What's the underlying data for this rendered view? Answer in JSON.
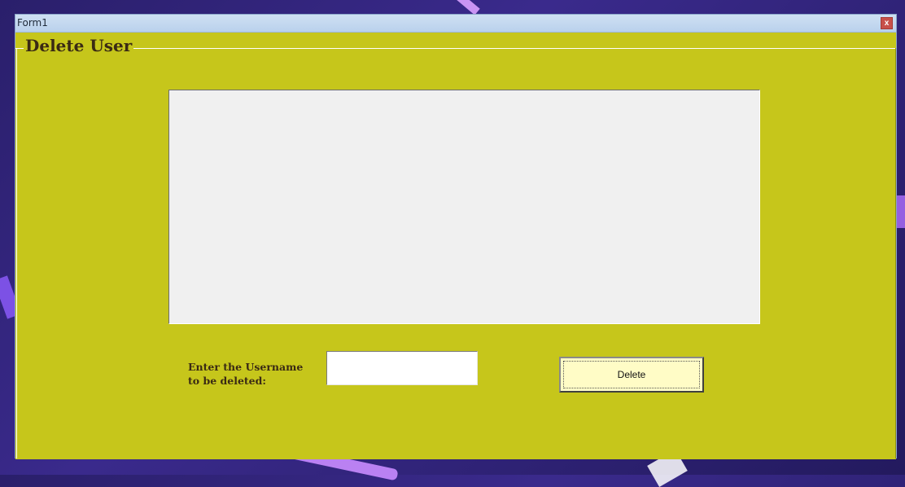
{
  "window": {
    "title": "Form1",
    "close_label": "x"
  },
  "group": {
    "title": "Delete User"
  },
  "form": {
    "label_line1": "Enter the Username",
    "label_line2": "to be deleted:",
    "username_value": "",
    "delete_label": "Delete"
  },
  "colors": {
    "form_background": "#c6c61b",
    "button_background": "#fffcc6",
    "listbox_background": "#f0f0f0"
  }
}
